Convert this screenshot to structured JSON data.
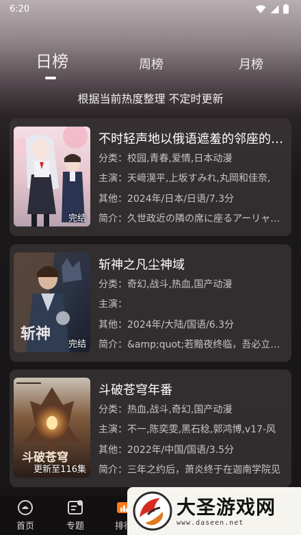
{
  "status_bar": {
    "time": "6:20"
  },
  "tabs": [
    {
      "label": "日榜",
      "active": true
    },
    {
      "label": "周榜",
      "active": false
    },
    {
      "label": "月榜",
      "active": false
    }
  ],
  "subtitle": "根据当前热度整理 不定时更新",
  "cards": [
    {
      "title": "不时轻声地以俄语遮羞的邻座的艾莉同学",
      "category": "分类：校园,青春,爱情,日本动漫",
      "cast": "主演：天﨑滉平,上坂すみれ,丸岡和佳奈,",
      "other": "其他：2024年/日本/日语/7.3分",
      "intro": "简介：久世政近の隣の席に座るアーリャさん",
      "badge": "完结"
    },
    {
      "title": "斩神之凡尘神域",
      "category": "分类：奇幻,战斗,热血,国产动漫",
      "cast": "主演：",
      "other": "其他：2024年/大陆/国语/6.3分",
      "intro": "简介：&amp;quot;若黯夜终临，吾必立于万",
      "badge": "完结",
      "cover_text": "斩神"
    },
    {
      "title": "斗破苍穹年番",
      "category": "分类：热血,战斗,奇幻,国产动漫",
      "cast": "主演：不一,陈奕雯,黑石稔,郭鸿博,v17-风",
      "other": "其他：2022年/中国/国语/3.5分",
      "intro": "简介：三年之约后，萧炎终于在迦南学院见",
      "badge": "更新至116集",
      "cover_text": "斗破苍穹"
    }
  ],
  "bottom_nav": [
    {
      "label": "首页",
      "icon": "home-icon"
    },
    {
      "label": "专题",
      "icon": "topic-icon"
    },
    {
      "label": "排行",
      "icon": "rank-icon"
    }
  ],
  "watermark": {
    "text": "大圣游戏网",
    "url": "www.daseen.net"
  }
}
